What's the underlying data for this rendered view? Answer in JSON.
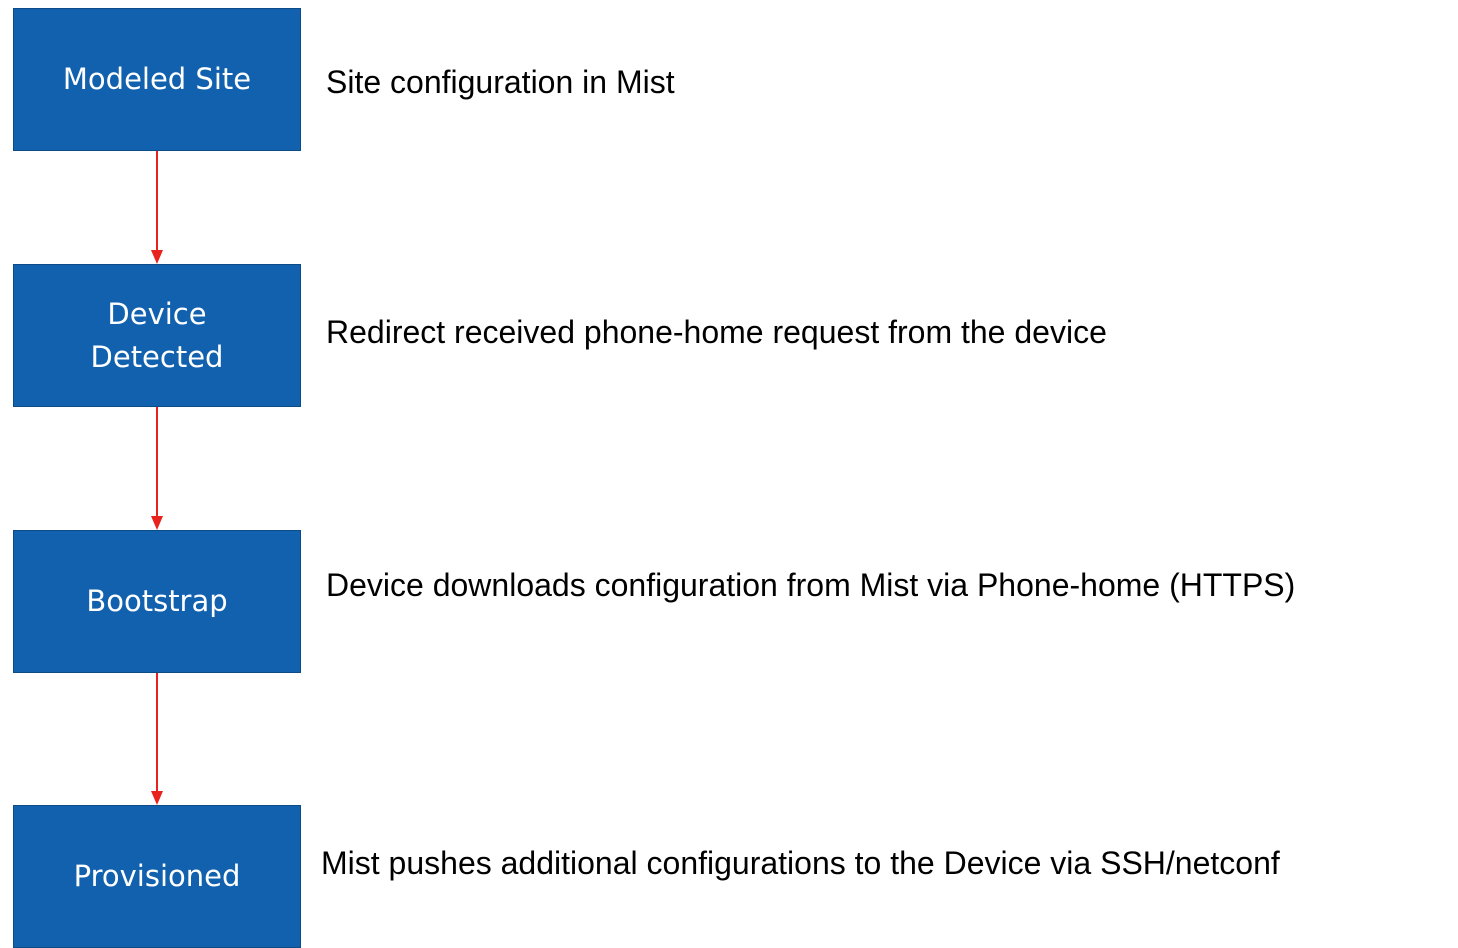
{
  "colors": {
    "box_fill": "#1261ae",
    "box_text": "#ffffff",
    "arrow": "#e8231d",
    "description_text": "#000000"
  },
  "stages": [
    {
      "label": "Modeled Site",
      "description": "Site configuration in Mist"
    },
    {
      "label": "Device\nDetected",
      "description": "Redirect received phone-home request from the device"
    },
    {
      "label": "Bootstrap",
      "description": "Device downloads configuration from Mist via Phone-home (HTTPS)"
    },
    {
      "label": "Provisioned",
      "description": "Mist pushes  additional configurations to the Device via SSH/netconf"
    }
  ]
}
